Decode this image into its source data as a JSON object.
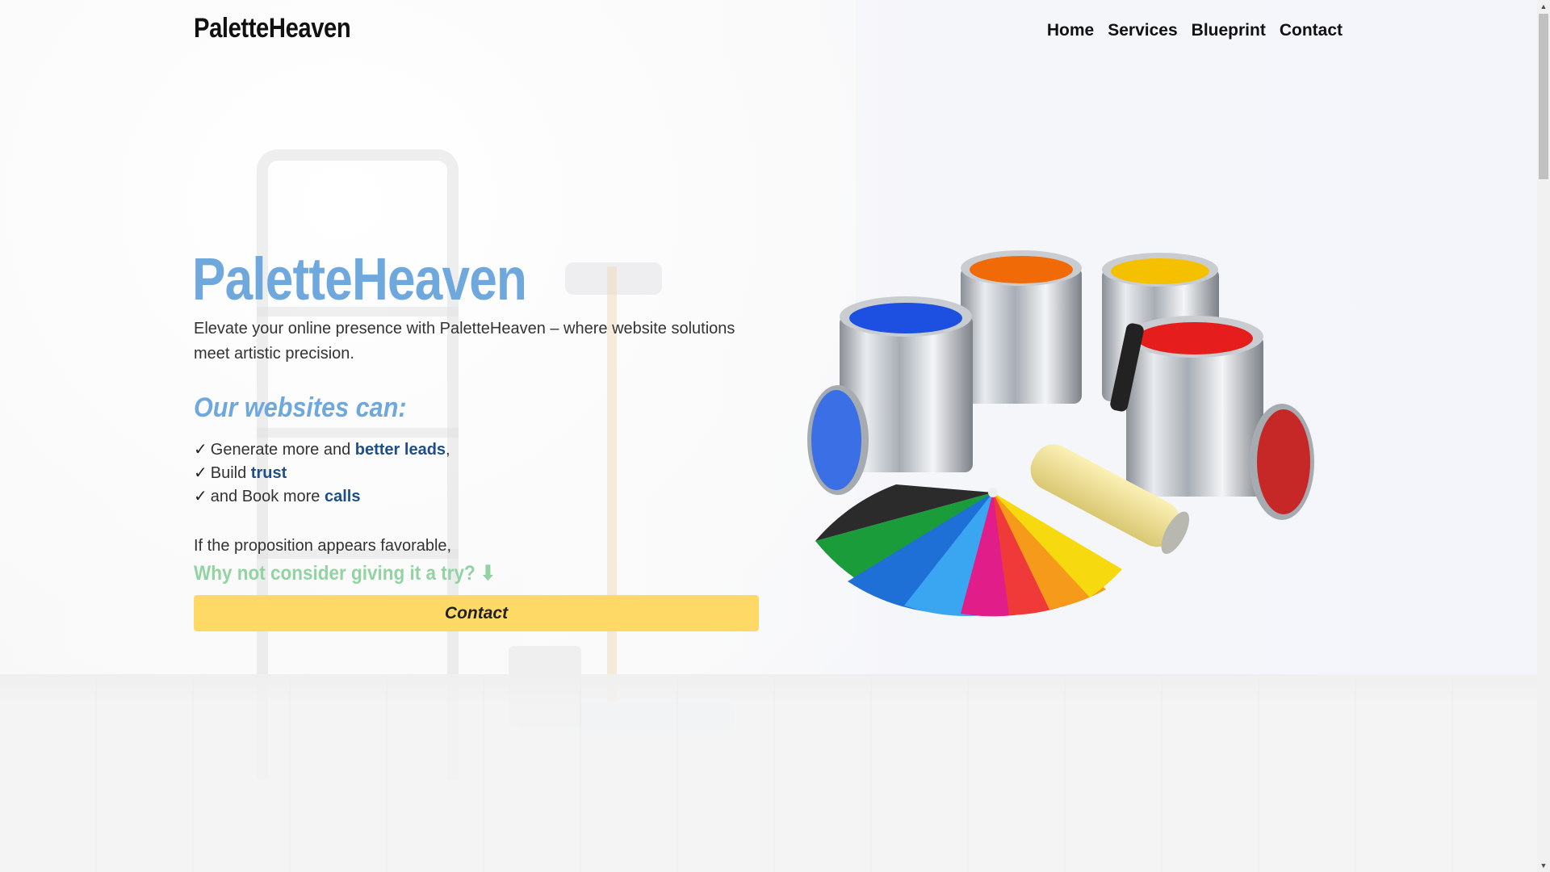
{
  "header": {
    "brand": "PaletteHeaven",
    "nav": [
      "Home",
      "Services",
      "Blueprint",
      "Contact"
    ]
  },
  "hero": {
    "title": "PaletteHeaven",
    "subtitle": "Elevate your online presence with PaletteHeaven – where website solutions meet artistic precision.",
    "can_heading": "Our websites can:",
    "benefits": [
      {
        "check": "✓",
        "pre": "Generate more and ",
        "highlight": "better leads",
        "post": ","
      },
      {
        "check": "✓",
        "pre": "Build ",
        "highlight": "trust",
        "post": ""
      },
      {
        "check": "✓",
        "pre": "and Book more ",
        "highlight": "calls",
        "post": ""
      }
    ],
    "proposition": "If the proposition appears favorable,",
    "try_text": "Why not consider giving it a try? ⬇",
    "contact_button": "Contact"
  },
  "colors": {
    "accent_blue": "#6fa8dc",
    "highlight_navy": "#1e4d8c",
    "accent_green": "#93d3a2",
    "button_yellow": "#ffd966"
  },
  "icons": {
    "check": "checkmark-icon",
    "down_arrow": "down-arrow-icon"
  }
}
